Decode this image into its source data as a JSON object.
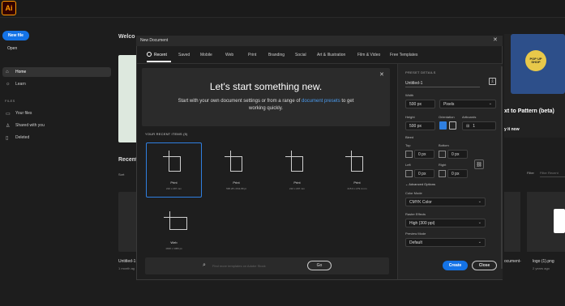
{
  "app": {
    "logo": "Ai"
  },
  "sidebar": {
    "new_file": "New file",
    "open": "Open",
    "home": "Home",
    "learn": "Learn",
    "files_heading": "FILES",
    "your_files": "Your files",
    "shared": "Shared with you",
    "deleted": "Deleted"
  },
  "background": {
    "welcome": "Welco",
    "recent": "Recent",
    "sort": "Sort",
    "untitled": "Untitled-1",
    "month": "1 month ag",
    "pattern_title": "xt to Pattern (beta)",
    "pattern_link": "y it now",
    "pattern_badge": "POP UP SHOP",
    "filter": "Filter",
    "filter_placeholder": "Filter Recent",
    "doc_name": "ocument-",
    "logo_file": "logo (1).png",
    "logo_time": "2 years ago"
  },
  "dialog": {
    "title": "New Document",
    "tabs": [
      "Recent",
      "Saved",
      "Mobile",
      "Web",
      "Print",
      "Branding",
      "Social",
      "Art & Illustration",
      "Film & Video",
      "Free Templates"
    ],
    "hero_title": "Let's start something new.",
    "hero_sub_pre": "Start with your own document settings or from a range of ",
    "hero_sub_link": "document presets",
    "hero_sub_post": " to get working quickly.",
    "recent_items_label": "YOUR RECENT ITEMS  (5)",
    "presets": [
      {
        "name": "Print",
        "size": "210 x 297 mm"
      },
      {
        "name": "Print",
        "size": "595.28 x 841.89 pt"
      },
      {
        "name": "Print",
        "size": "210 x 297 mm"
      },
      {
        "name": "Print",
        "size": "215.9 x 279.4 mm"
      },
      {
        "name": "Web",
        "size": "1920 x 1080 px"
      }
    ],
    "search_placeholder": "Find more templates on Adobe Stock",
    "go": "Go",
    "create": "Create",
    "close": "Close"
  },
  "details": {
    "heading": "PRESET DETAILS",
    "doc_name": "Untitled-1",
    "width_label": "Width",
    "width_value": "500 px",
    "units_value": "Pixels",
    "height_label": "Height",
    "height_value": "500 px",
    "orientation_label": "Orientation",
    "artboards_label": "Artboards",
    "artboards_value": "1",
    "bleed_label": "Bleed",
    "top_label": "Top",
    "top_value": "0 px",
    "bottom_label": "Bottom",
    "bottom_value": "0 px",
    "left_label": "Left",
    "left_value": "0 px",
    "right_label": "Right",
    "right_value": "0 px",
    "advanced": "Advanced Options",
    "color_mode_label": "Color Mode",
    "color_mode_value": "CMYK Color",
    "raster_label": "Raster Effects",
    "raster_value": "High (300 ppi)",
    "preview_label": "Preview Mode",
    "preview_value": "Default"
  },
  "colors": {
    "accent": "#1473e6",
    "selection": "#2f7fe0",
    "logo": "#ff9a00"
  }
}
